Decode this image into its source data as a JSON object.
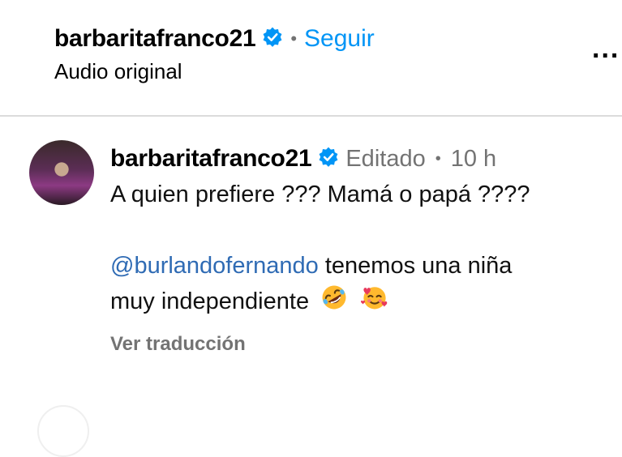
{
  "header": {
    "username": "barbaritafranco21",
    "separator": "•",
    "follow_label": "Seguir",
    "subtitle": "Audio original",
    "more_label": "..."
  },
  "comment": {
    "username": "barbaritafranco21",
    "edited_label": "Editado",
    "separator": "•",
    "time": "10 h",
    "line1": "A quien prefiere ??? Mamá o papá ????",
    "mention": "@burlandofernando",
    "line2_rest": " tenemos una niña",
    "line3": "muy independiente",
    "translate_label": "Ver traducción",
    "emojis": [
      "rolling-on-floor-laughing-emoji",
      "smiling-face-with-hearts-emoji"
    ]
  },
  "colors": {
    "accent": "#0095f6",
    "mention": "#2f6bb4",
    "muted": "#737373",
    "verified": "#0095f6"
  }
}
